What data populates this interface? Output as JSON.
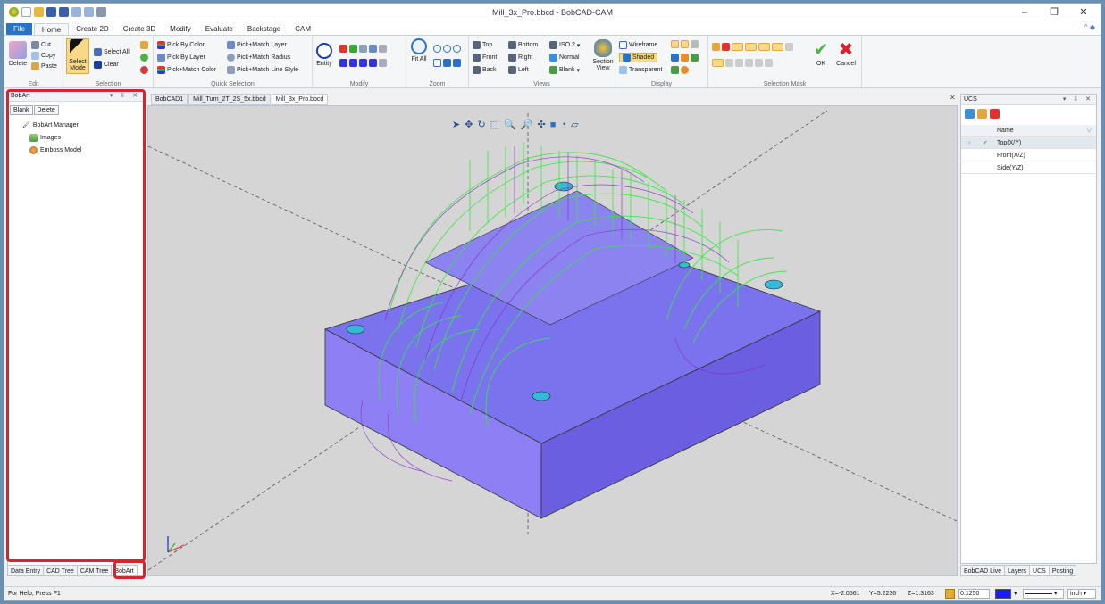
{
  "window": {
    "title": "Mill_3x_Pro.bbcd - BobCAD-CAM",
    "controls": {
      "minimize": "–",
      "restore": "❐",
      "close": "✕"
    }
  },
  "menu": {
    "file": "File",
    "tabs": [
      "Home",
      "Create 2D",
      "Create 3D",
      "Modify",
      "Evaluate",
      "Backstage",
      "CAM"
    ]
  },
  "ribbon": {
    "edit": {
      "label": "Edit",
      "delete": "Delete",
      "cut": "Cut",
      "copy": "Copy",
      "paste": "Paste"
    },
    "selection": {
      "label": "Selection",
      "select_mode": "Select Mode",
      "select_all": "Select All",
      "clear": "Clear"
    },
    "quick_selection": {
      "label": "Quick Selection",
      "pick_by_color": "Pick By Color",
      "pick_by_layer": "Pick By Layer",
      "pick_match_color": "Pick+Match Color",
      "pick_match_layer": "Pick+Match Layer",
      "pick_match_radius": "Pick+Match Radius",
      "pick_match_line_style": "Pick+Match Line Style"
    },
    "modify": {
      "label": "Modify",
      "entity": "Entity"
    },
    "zoom": {
      "label": "Zoom",
      "fit_all": "Fit All"
    },
    "views": {
      "label": "Views",
      "top": "Top",
      "bottom": "Bottom",
      "iso2": "ISO 2",
      "front": "Front",
      "right": "Right",
      "normal": "Normal",
      "back": "Back",
      "left": "Left",
      "blank": "Blank",
      "section_view": "Section View"
    },
    "display": {
      "label": "Display",
      "wireframe": "Wireframe",
      "shaded": "Shaded",
      "transparent": "Transparent"
    },
    "selection_mask": {
      "label": "Selection Mask"
    },
    "ok": "OK",
    "cancel": "Cancel"
  },
  "left_panel": {
    "title": "BobArt",
    "controls": "▾ ⇩ ✕",
    "toolbar": [
      "Blank",
      "Delete"
    ],
    "tree": [
      "BobArt Manager",
      "Images",
      "Emboss Model"
    ],
    "bottom_tabs": [
      "Data Entry",
      "CAD Tree",
      "CAM Tree",
      "BobArt"
    ],
    "selected_tab": "BobArt"
  },
  "documents": {
    "close_all": "✕",
    "tabs": [
      "BobCAD1",
      "Mill_Turn_2T_2S_5x.bbcd",
      "Mill_3x_Pro.bbcd"
    ],
    "active": "Mill_3x_Pro.bbcd"
  },
  "right_panel": {
    "title": "UCS",
    "controls": "▾ ⇩ ✕",
    "column": "Name",
    "rows": [
      "Top(X/Y)",
      "Front(X/Z)",
      "Side(Y/Z)"
    ],
    "active_row": "Top(X/Y)",
    "bottom_tabs": [
      "BobCAD Live",
      "Layers",
      "UCS",
      "Posting"
    ],
    "selected_tab": "UCS"
  },
  "status": {
    "help": "For Help, Press F1",
    "x": "X=-2.0561",
    "y": "Y=5.2236",
    "z": "Z=1.3163",
    "line_width": "0.1250",
    "units": "inch"
  },
  "colors": {
    "accent": "#2b72c4",
    "highlight": "#d9242f",
    "model": "#7b6cf0",
    "toolpath": "#36e840",
    "viewport_bg": "#d5d5d5",
    "swatch": "#1b1bff"
  }
}
